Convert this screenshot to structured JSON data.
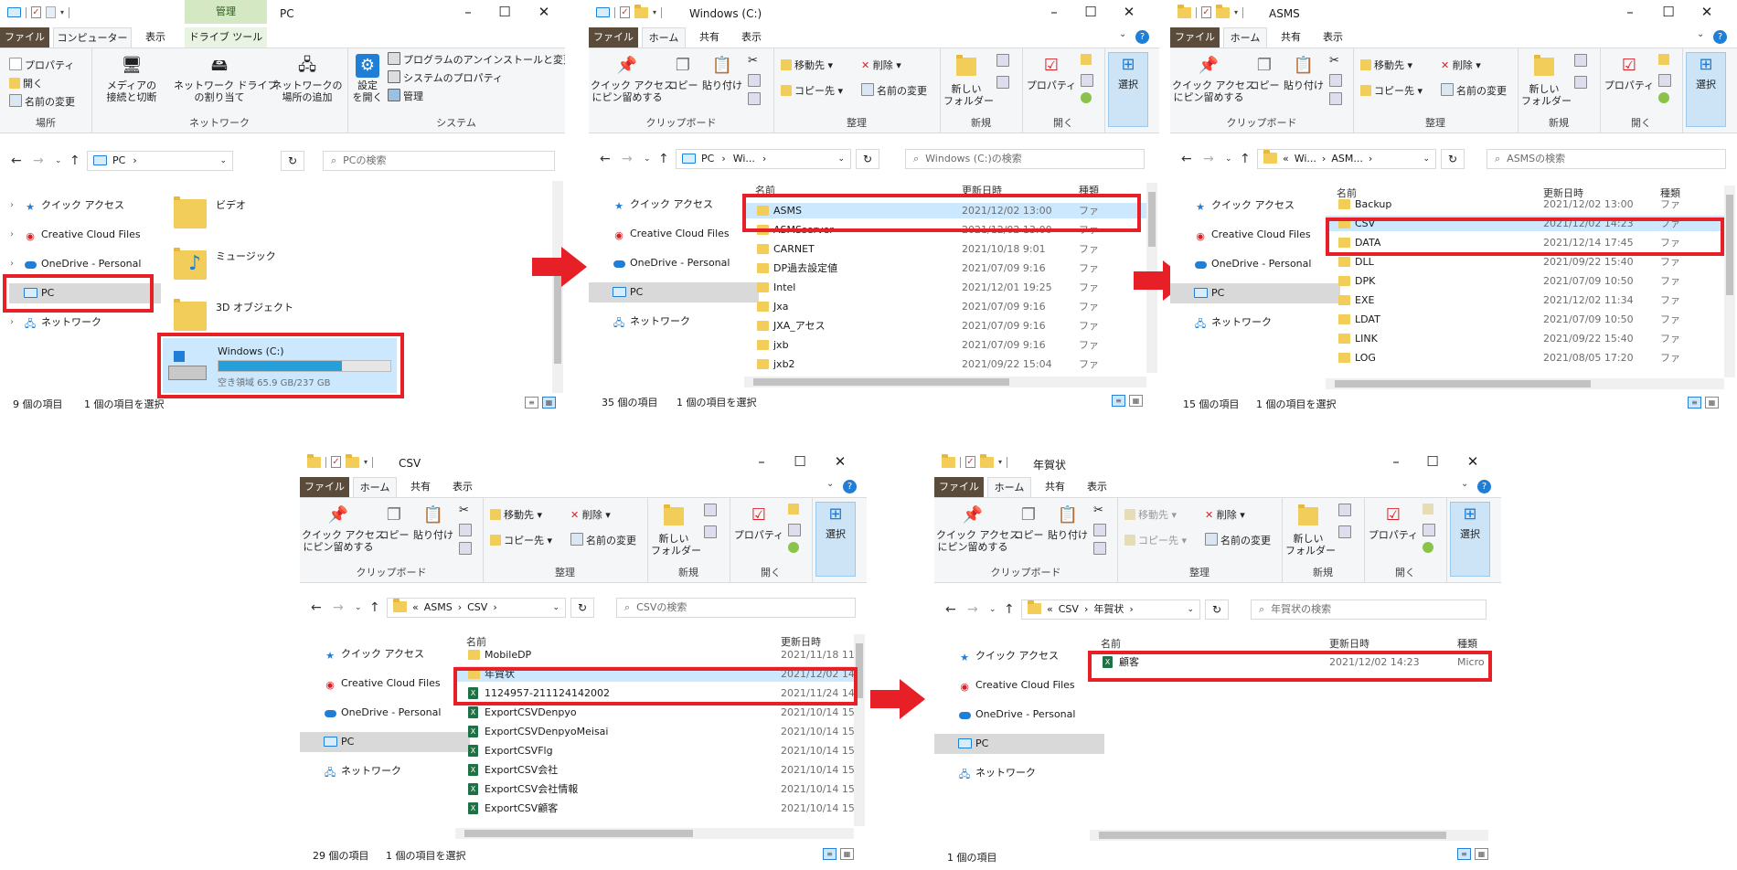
{
  "common": {
    "tabs": {
      "file": "ファイル",
      "home": "ホーム",
      "share": "共有",
      "view": "表示"
    },
    "ribbon": {
      "pin": "クイック アクセス\nにピン留めする",
      "copy": "コピー",
      "paste": "貼り付け",
      "move_to": "移動先",
      "copy_to": "コピー先",
      "delete": "削除",
      "rename": "名前の変更",
      "new_folder": "新しい\nフォルダー",
      "properties": "プロパティ",
      "select": "選択",
      "clipboard": "クリップボード",
      "organize": "整理",
      "new_group": "新規",
      "open_group": "開く"
    },
    "nav": {
      "quick_access": "クイック アクセス",
      "creative_cloud": "Creative Cloud Files",
      "onedrive": "OneDrive - Personal",
      "pc": "PC",
      "network": "ネットワーク"
    },
    "columns": {
      "name": "名前",
      "date": "更新日時",
      "type": "種類"
    },
    "selected_status": "1 個の項目を選択",
    "help": "?"
  },
  "win1": {
    "title": "PC",
    "context_tab": "管理",
    "tabs": {
      "computer": "コンピューター",
      "view": "表示",
      "drive_tools": "ドライブ ツール"
    },
    "ribbon": {
      "properties": "プロパティ",
      "open": "開く",
      "rename": "名前の変更",
      "location_group": "場所",
      "media": "メディアの\n接続と切断",
      "map_drive": "ネットワーク ドライブ\nの割り当て",
      "add_location": "ネットワークの\n場所の追加",
      "network_group": "ネットワーク",
      "settings": "設定\nを開く",
      "uninstall": "プログラムのアンインストールと変更",
      "sys_props": "システムのプロパティ",
      "manage": "管理",
      "system_group": "システム"
    },
    "address": "PC",
    "search_placeholder": "PCの検索",
    "items": [
      {
        "name": "ビデオ"
      },
      {
        "name": "ミュージック"
      },
      {
        "name": "3D オブジェクト"
      }
    ],
    "drive": {
      "name": "Windows (C:)",
      "free": "空き領域 65.9 GB/237 GB",
      "used_fraction": 0.72
    },
    "status_count": "9 個の項目"
  },
  "win2": {
    "title": "Windows (C:)",
    "address": [
      "PC",
      "Wi..."
    ],
    "search_placeholder": "Windows (C:)の検索",
    "rows": [
      {
        "name": "ASMS",
        "date": "2021/12/02 13:00",
        "type": "ファ"
      },
      {
        "name": "ASMSserver",
        "date": "2021/12/02 13:00",
        "type": "ファ"
      },
      {
        "name": "CARNET",
        "date": "2021/10/18 9:01",
        "type": "ファ"
      },
      {
        "name": "DP過去設定値",
        "date": "2021/07/09 9:16",
        "type": "ファ"
      },
      {
        "name": "Intel",
        "date": "2021/12/01 19:25",
        "type": "ファ"
      },
      {
        "name": "Jxa",
        "date": "2021/07/09 9:16",
        "type": "ファ"
      },
      {
        "name": "JXA_アセス",
        "date": "2021/07/09 9:16",
        "type": "ファ"
      },
      {
        "name": "jxb",
        "date": "2021/07/09 9:16",
        "type": "ファ"
      },
      {
        "name": "jxb2",
        "date": "2021/09/22 15:04",
        "type": "ファ"
      }
    ],
    "status_count": "35 個の項目"
  },
  "win3": {
    "title": "ASMS",
    "address": [
      "«",
      "Wi...",
      "ASM..."
    ],
    "search_placeholder": "ASMSの検索",
    "rows": [
      {
        "name": "Backup",
        "date": "2021/12/02 13:00",
        "type": "ファ"
      },
      {
        "name": "CSV",
        "date": "2021/12/02 14:23",
        "type": "ファ"
      },
      {
        "name": "DATA",
        "date": "2021/12/14 17:45",
        "type": "ファ"
      },
      {
        "name": "DLL",
        "date": "2021/09/22 15:40",
        "type": "ファ"
      },
      {
        "name": "DPK",
        "date": "2021/07/09 10:50",
        "type": "ファ"
      },
      {
        "name": "EXE",
        "date": "2021/12/02 11:34",
        "type": "ファ"
      },
      {
        "name": "LDAT",
        "date": "2021/07/09 10:50",
        "type": "ファ"
      },
      {
        "name": "LINK",
        "date": "2021/09/22 15:40",
        "type": "ファ"
      },
      {
        "name": "LOG",
        "date": "2021/08/05 17:20",
        "type": "ファ"
      }
    ],
    "status_count": "15 個の項目"
  },
  "win4": {
    "title": "CSV",
    "address": [
      "«",
      "ASMS",
      "CSV"
    ],
    "search_placeholder": "CSVの検索",
    "rows": [
      {
        "name": "MobileDP",
        "date": "2021/11/18 11:",
        "kind": "folder"
      },
      {
        "name": "年賀状",
        "date": "2021/12/02 14:",
        "kind": "folder"
      },
      {
        "name": "1124957-211124142002",
        "date": "2021/11/24 14:",
        "kind": "excel"
      },
      {
        "name": "ExportCSVDenpyo",
        "date": "2021/10/14 15:",
        "kind": "excel"
      },
      {
        "name": "ExportCSVDenpyoMeisai",
        "date": "2021/10/14 15:",
        "kind": "excel"
      },
      {
        "name": "ExportCSVFlg",
        "date": "2021/10/14 15:",
        "kind": "excel"
      },
      {
        "name": "ExportCSV会社",
        "date": "2021/10/14 15:",
        "kind": "excel"
      },
      {
        "name": "ExportCSV会社情報",
        "date": "2021/10/14 15:",
        "kind": "excel"
      },
      {
        "name": "ExportCSV顧客",
        "date": "2021/10/14 15:",
        "kind": "excel"
      }
    ],
    "status_count": "29 個の項目"
  },
  "win5": {
    "title": "年賀状",
    "address": [
      "«",
      "CSV",
      "年賀状"
    ],
    "search_placeholder": "年賀状の検索",
    "rows": [
      {
        "name": "顧客",
        "date": "2021/12/02 14:23",
        "type": "Micro",
        "kind": "excel"
      }
    ],
    "status_count": "1 個の項目"
  },
  "colors": {
    "highlight": "#e71f26",
    "selection": "#cce8ff",
    "accent": "#1f7ed6",
    "file_tab": "#5a4b3a"
  }
}
